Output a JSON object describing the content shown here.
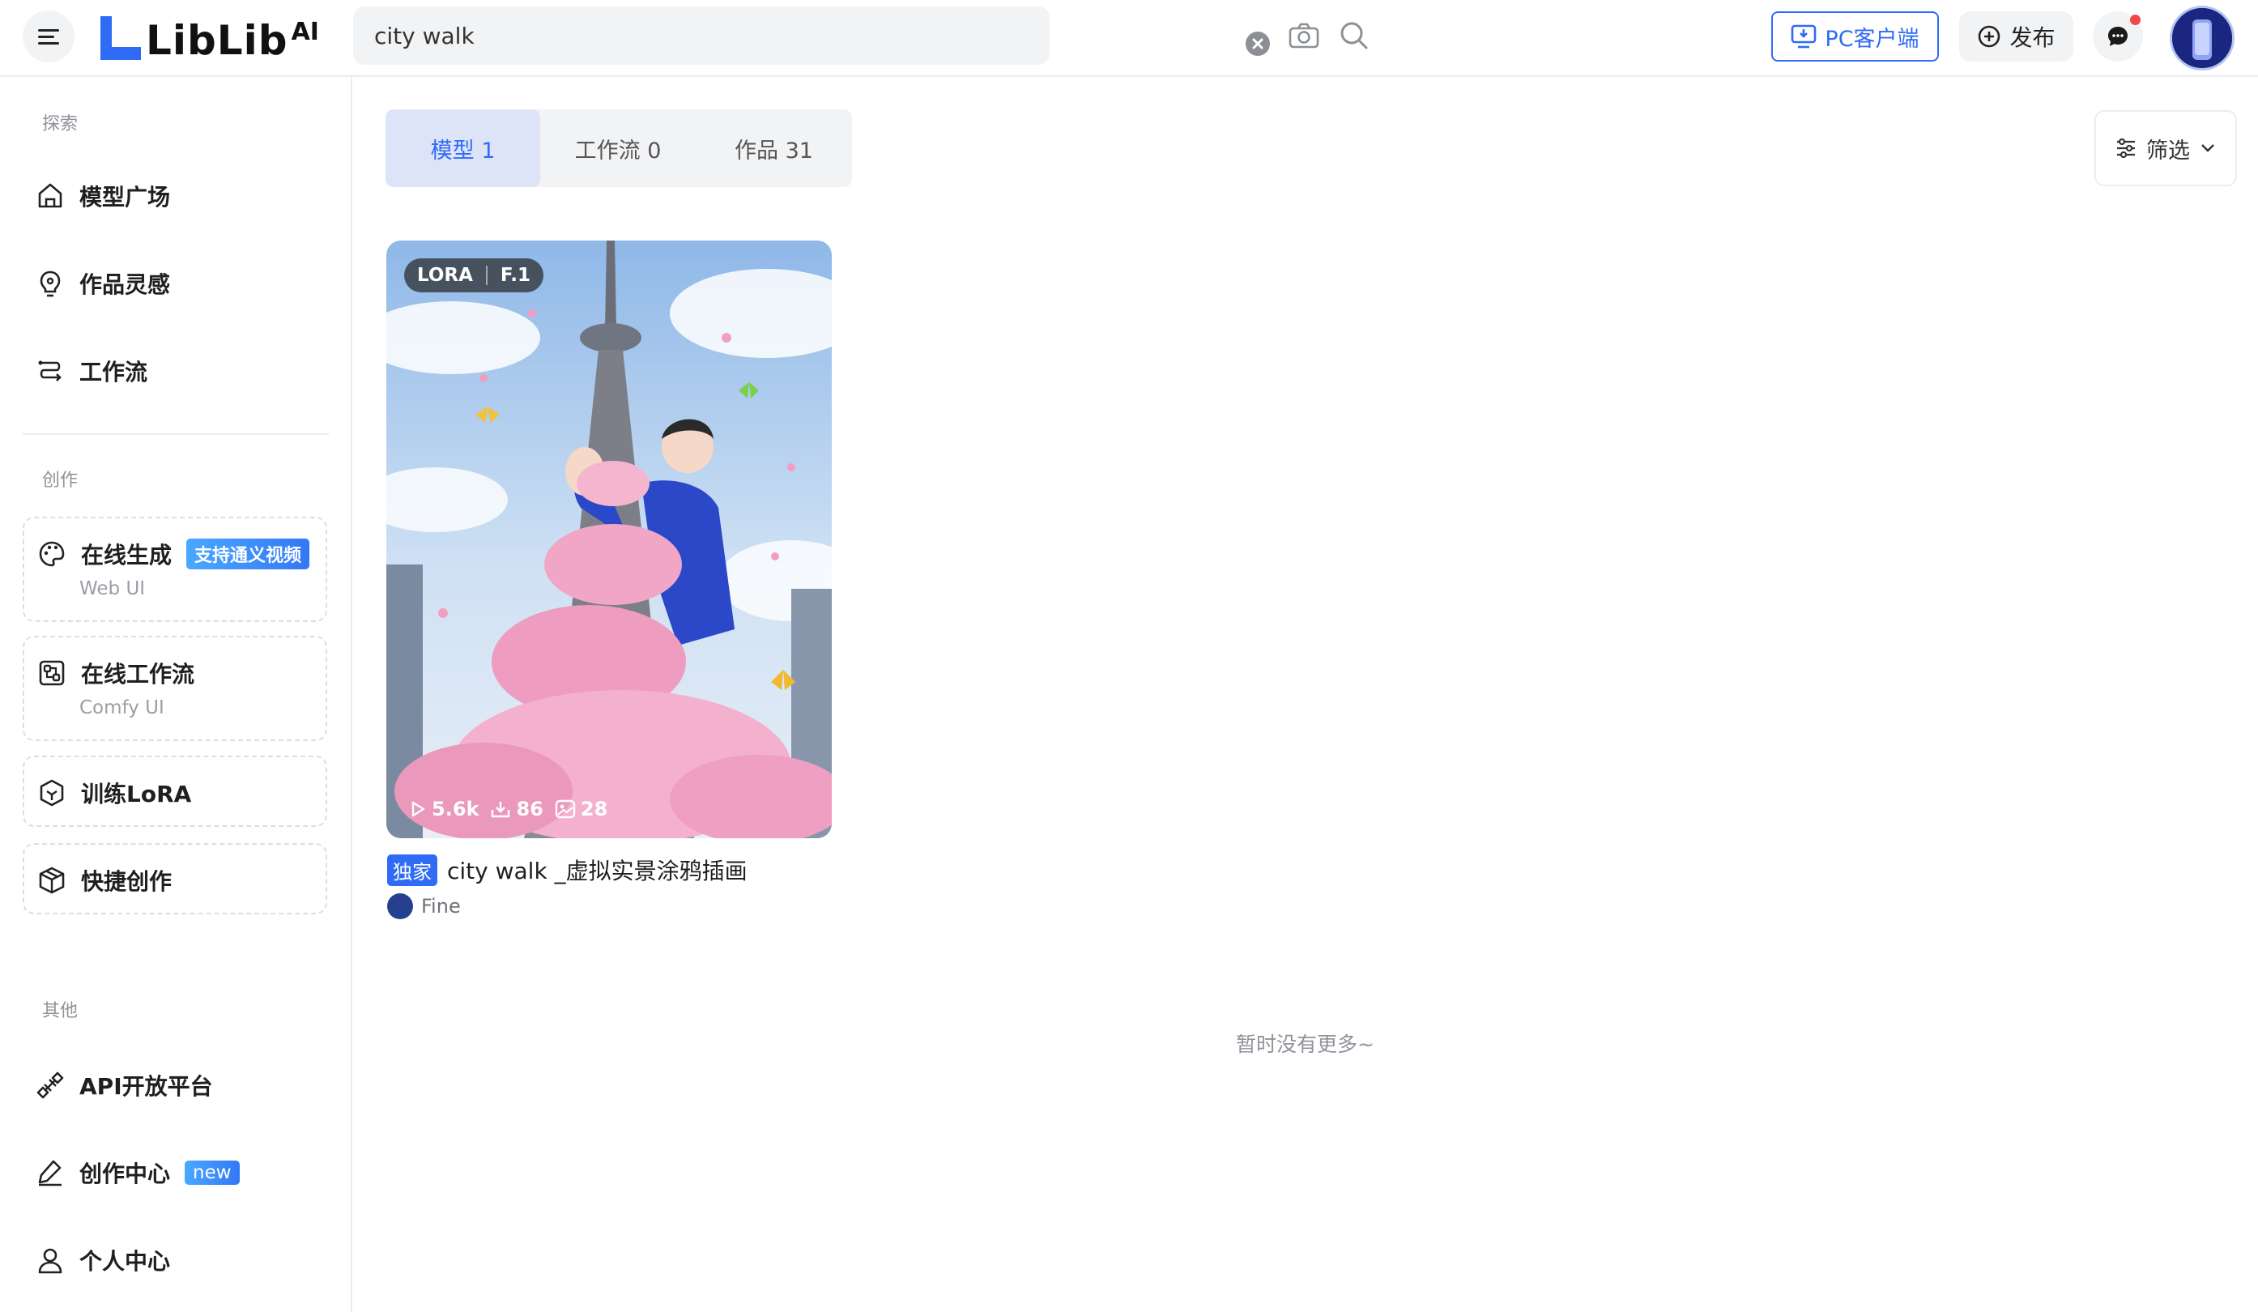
{
  "brand": {
    "name": "LibLib",
    "suffix": "AI",
    "accent": "#2f6bf5"
  },
  "search": {
    "value": "city walk",
    "placeholder": ""
  },
  "header": {
    "pc_client_label": "PC客户端",
    "publish_label": "发布"
  },
  "sidebar": {
    "explore_title": "探索",
    "explore_items": [
      {
        "label": "模型广场",
        "icon": "home-icon"
      },
      {
        "label": "作品灵感",
        "icon": "bulb-icon"
      },
      {
        "label": "工作流",
        "icon": "workflow-icon"
      }
    ],
    "create_title": "创作",
    "tools": [
      {
        "label": "在线生成",
        "badge": "支持通义视频",
        "sub": "Web UI",
        "icon": "palette-icon"
      },
      {
        "label": "在线工作流",
        "sub": "Comfy UI",
        "icon": "node-icon"
      },
      {
        "label": "训练LoRA",
        "icon": "cube-icon"
      },
      {
        "label": "快捷创作",
        "icon": "box-icon"
      }
    ],
    "other_title": "其他",
    "other_items": [
      {
        "label": "API开放平台",
        "icon": "api-icon"
      },
      {
        "label": "创作中心",
        "badge": "new",
        "icon": "pen-icon"
      },
      {
        "label": "个人中心",
        "icon": "user-icon"
      }
    ]
  },
  "tabs": [
    {
      "label": "模型 1",
      "active": true
    },
    {
      "label": "工作流 0",
      "active": false
    },
    {
      "label": "作品 31",
      "active": false
    }
  ],
  "filter_label": "筛选",
  "results": [
    {
      "tags": [
        "LORA",
        "F.1"
      ],
      "stats": {
        "runs": "5.6k",
        "downloads": "86",
        "images": "28"
      },
      "exclusive_label": "独家",
      "title": "city walk _虚拟实景涂鸦插画",
      "author": "Fine"
    }
  ],
  "empty_more": "暂时没有更多~"
}
